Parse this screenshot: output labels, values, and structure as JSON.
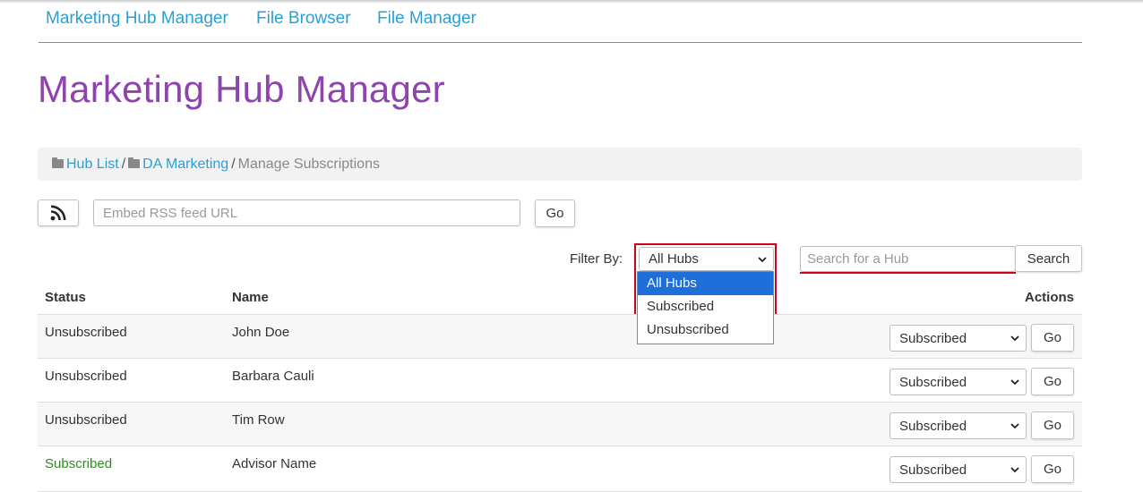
{
  "nav": {
    "links": [
      "Marketing Hub Manager",
      "File Browser",
      "File Manager"
    ]
  },
  "page_title": "Marketing Hub Manager",
  "breadcrumb": {
    "items": [
      "Hub List",
      "DA Marketing"
    ],
    "current": "Manage Subscriptions"
  },
  "rss": {
    "icon": "rss-icon",
    "placeholder": "Embed RSS feed URL",
    "go_label": "Go"
  },
  "filter": {
    "label": "Filter By:",
    "selected": "All Hubs",
    "options": [
      "All Hubs",
      "Subscribed",
      "Unsubscribed"
    ]
  },
  "search": {
    "placeholder": "Search for a Hub",
    "button_label": "Search"
  },
  "table": {
    "headers": {
      "status": "Status",
      "name": "Name",
      "actions": "Actions"
    },
    "rows": [
      {
        "status": "Unsubscribed",
        "name": "John Doe",
        "action_value": "Subscribed",
        "go": "Go"
      },
      {
        "status": "Unsubscribed",
        "name": "Barbara Cauli",
        "action_value": "Subscribed",
        "go": "Go"
      },
      {
        "status": "Unsubscribed",
        "name": "Tim Row",
        "action_value": "Subscribed",
        "go": "Go"
      },
      {
        "status": "Subscribed",
        "name": "Advisor Name",
        "action_value": "Subscribed",
        "go": "Go"
      }
    ]
  },
  "colors": {
    "link": "#2a9fd6",
    "title": "#8e44ad",
    "subscribed_status": "#2e8b1f",
    "highlight": "#d0021b",
    "option_selected": "#1e6fd9"
  }
}
